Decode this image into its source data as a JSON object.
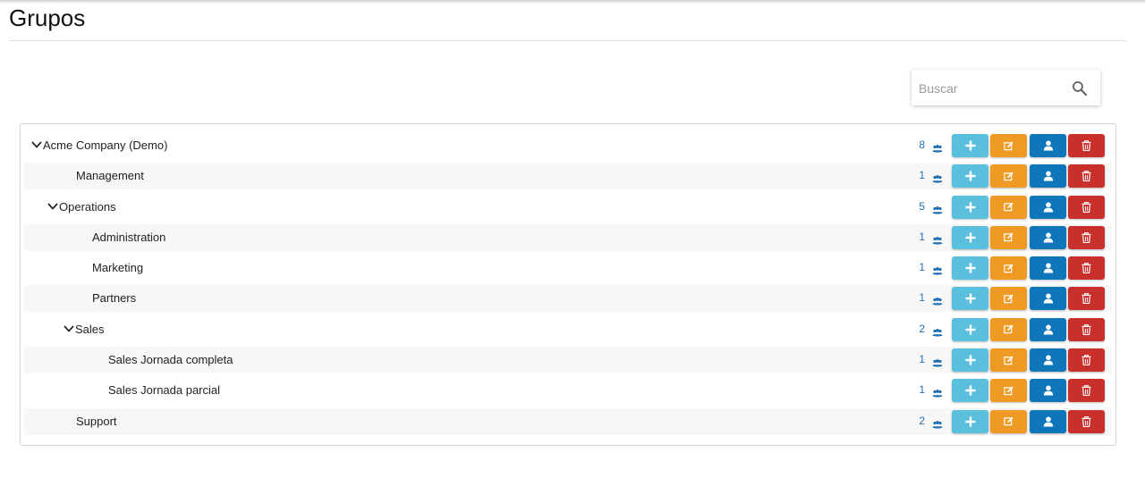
{
  "page": {
    "title": "Grupos"
  },
  "search": {
    "placeholder": "Buscar",
    "value": ""
  },
  "colors": {
    "add": "#5bc0de",
    "edit": "#ef9a25",
    "users": "#0f76ba",
    "delete": "#c9302c",
    "count": "#1e6fb4",
    "stripe": "#f7f7f7"
  },
  "groups": [
    {
      "name": "Acme Company (Demo)",
      "level": 0,
      "expanded": true,
      "count": "8"
    },
    {
      "name": "Management",
      "level": 1,
      "expanded": false,
      "count": "1"
    },
    {
      "name": "Operations",
      "level": 1,
      "expanded": true,
      "count": "5"
    },
    {
      "name": "Administration",
      "level": 2,
      "expanded": false,
      "count": "1"
    },
    {
      "name": "Marketing",
      "level": 2,
      "expanded": false,
      "count": "1"
    },
    {
      "name": "Partners",
      "level": 2,
      "expanded": false,
      "count": "1"
    },
    {
      "name": "Sales",
      "level": 2,
      "expanded": true,
      "count": "2"
    },
    {
      "name": "Sales Jornada completa",
      "level": 3,
      "expanded": false,
      "count": "1"
    },
    {
      "name": "Sales Jornada parcial",
      "level": 3,
      "expanded": false,
      "count": "1"
    },
    {
      "name": "Support",
      "level": 1,
      "expanded": false,
      "count": "2"
    }
  ],
  "icons": {
    "toggle": "chevron-down-icon",
    "members": "group-icon",
    "add": "plus-icon",
    "edit": "edit-icon",
    "users": "user-icon",
    "delete": "trash-icon",
    "search": "search-icon"
  }
}
